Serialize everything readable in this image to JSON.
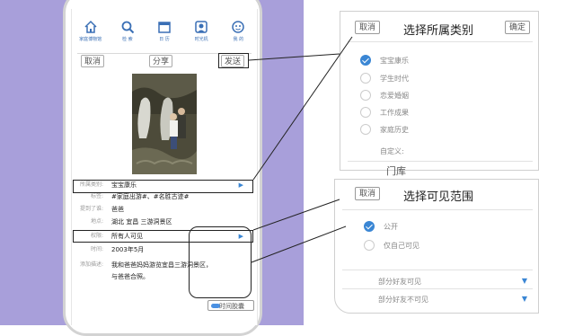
{
  "nav": [
    {
      "label": "家庭博物馆",
      "icon": "home-icon"
    },
    {
      "label": "检 索",
      "icon": "search-icon"
    },
    {
      "label": "日 历",
      "icon": "calendar-icon"
    },
    {
      "label": "时光机",
      "icon": "time-machine-icon"
    },
    {
      "label": "我 的",
      "icon": "user-icon"
    }
  ],
  "toolbar": {
    "cancel": "取消",
    "share": "分享",
    "send": "发送"
  },
  "form": {
    "category_label": "所属类别:",
    "category_value": "宝宝康乐",
    "tags_label": "标签:",
    "tags_value": "#家庭出游#、#名胜古迹#",
    "mention_label": "提到了谁:",
    "mention_value": "爸爸",
    "place_label": "地点:",
    "place_value": "湖北 宜昌 三游洞景区",
    "perm_label": "权限:",
    "perm_value": "所有人可见",
    "time_label": "时间:",
    "time_value": "2003年5月",
    "desc_label": "添加描述:",
    "desc_line1": "我和爸爸妈妈游览宜昌三游洞景区，",
    "desc_line2": "与爸爸合照。"
  },
  "capsule_label": "时间胶囊",
  "category_popup": {
    "title": "选择所属类别",
    "cancel": "取消",
    "confirm": "确定",
    "options": [
      "宝宝康乐",
      "学生时代",
      "恋爱婚姻",
      "工作成果",
      "家庭历史"
    ],
    "selected_index": 0,
    "custom_label": "自定义:",
    "peek_text": "门库"
  },
  "visibility_popup": {
    "title": "选择可见范围",
    "cancel": "取消",
    "options": [
      "公开",
      "仅自己可见"
    ],
    "selected_index": 0,
    "partial_visible": "部分好友可见",
    "partial_hidden": "部分好友不可见"
  },
  "colors": {
    "accent": "#3a86d4",
    "nav_text": "#3a6fb5",
    "background_left": "#a89fda"
  }
}
